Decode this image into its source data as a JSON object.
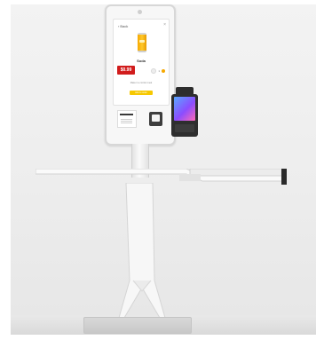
{
  "kiosk": {
    "screen": {
      "back_label": "Back",
      "product_name": "Soda",
      "price": "$0.99",
      "qty_value": "1",
      "info_text": "Make it a combo meal",
      "add_button_label": "Add to order"
    }
  }
}
